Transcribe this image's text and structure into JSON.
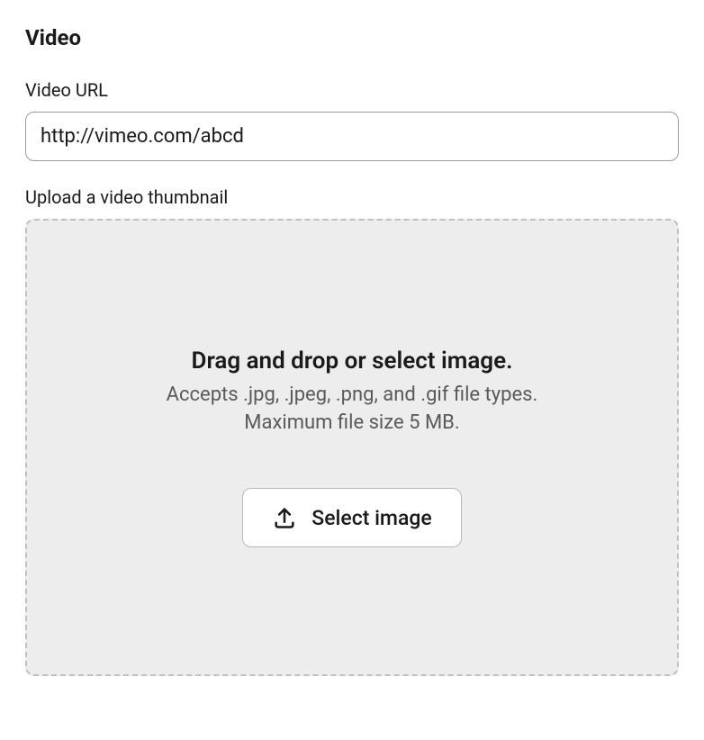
{
  "section": {
    "title": "Video"
  },
  "video_url": {
    "label": "Video URL",
    "value": "http://vimeo.com/abcd"
  },
  "thumbnail": {
    "label": "Upload a video thumbnail",
    "dropzone": {
      "title": "Drag and drop or select image.",
      "accepts": "Accepts .jpg, .jpeg, .png, and .gif file types.",
      "maxsize": "Maximum file size 5 MB.",
      "button_label": "Select image"
    }
  }
}
